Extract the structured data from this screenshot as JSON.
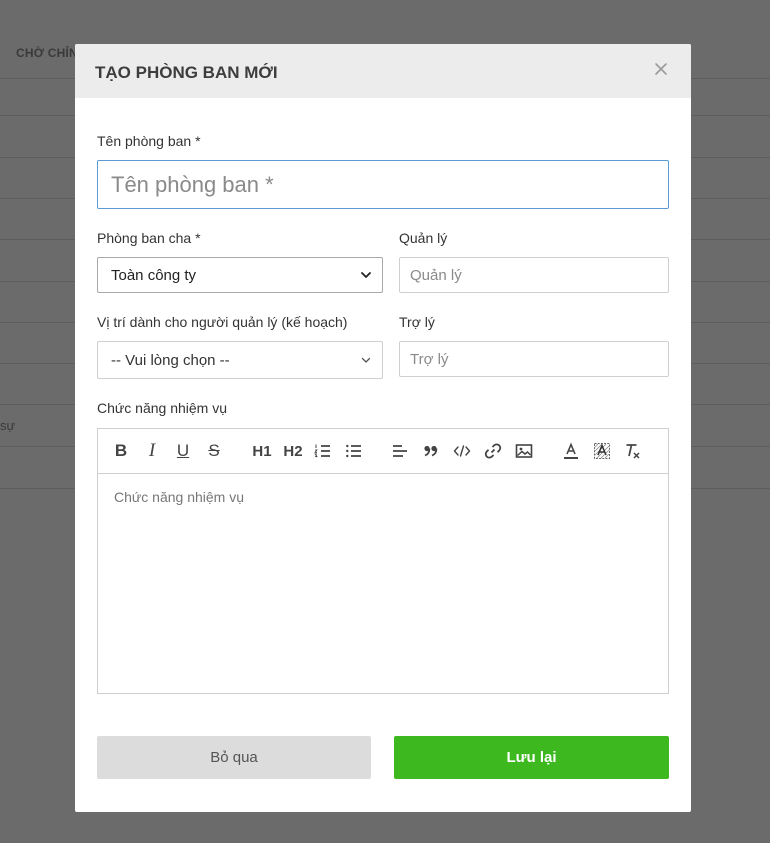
{
  "background": {
    "header_text": "CHỜ CHỈN",
    "side_text": "sự"
  },
  "modal": {
    "title": "TẠO PHÒNG BAN MỚI",
    "close_symbol": "×",
    "name_field": {
      "label": "Tên phòng ban *",
      "placeholder": "Tên phòng ban *",
      "value": ""
    },
    "parent_field": {
      "label": "Phòng ban cha *",
      "selected": "Toàn công ty"
    },
    "manager_field": {
      "label": "Quản lý",
      "placeholder": "Quản lý"
    },
    "position_field": {
      "label": "Vị trí dành cho người quản lý (kế hoạch)",
      "selected": "-- Vui lòng chọn --"
    },
    "assistant_field": {
      "label": "Trợ lý",
      "placeholder": "Trợ lý"
    },
    "duties_field": {
      "label": "Chức năng nhiệm vụ",
      "placeholder": "Chức năng nhiệm vụ"
    },
    "toolbar": {
      "bold": "B",
      "italic": "I",
      "underline": "U",
      "strike": "S",
      "h1": "H1",
      "h2": "H2"
    },
    "cancel_label": "Bỏ qua",
    "save_label": "Lưu lại"
  },
  "colors": {
    "save_button": "#3db81f",
    "cancel_button": "#dcdcdc",
    "focus_border": "#5b9bd5",
    "overlay": "#6b6b6b"
  }
}
